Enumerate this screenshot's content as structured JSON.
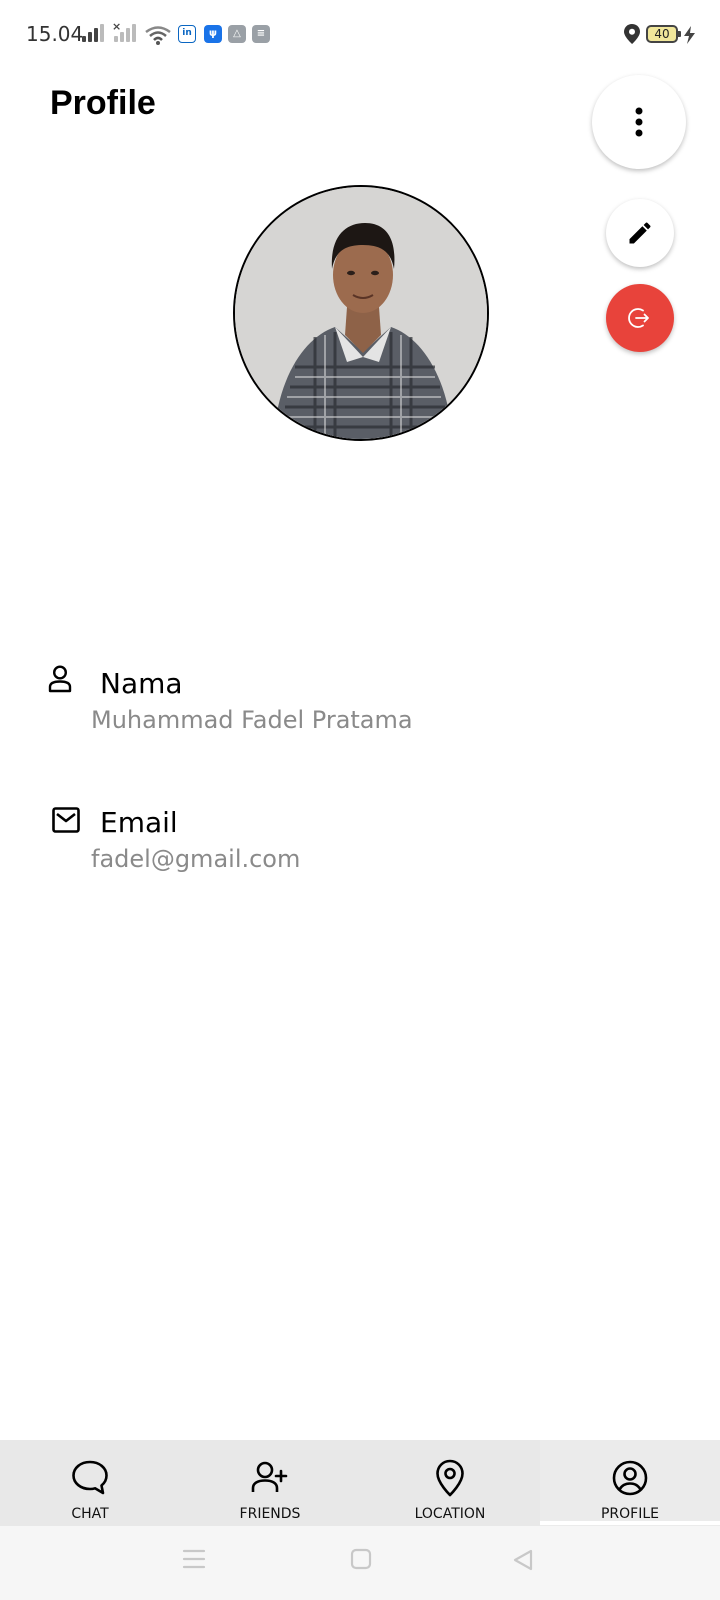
{
  "status_bar": {
    "time": "15.04",
    "battery_level": "40"
  },
  "header": {
    "title": "Profile"
  },
  "profile": {
    "name_label": "Nama",
    "name_value": "Muhammad Fadel Pratama",
    "email_label": "Email",
    "email_value": "fadel@gmail.com"
  },
  "bottom_nav": {
    "items": [
      {
        "label": "CHAT",
        "icon": "chat-bubble-icon"
      },
      {
        "label": "FRIENDS",
        "icon": "add-person-icon"
      },
      {
        "label": "LOCATION",
        "icon": "location-pin-icon"
      },
      {
        "label": "PROFILE",
        "icon": "account-circle-icon"
      }
    ],
    "active_index": 3
  },
  "colors": {
    "logout_fab": "#e8433b",
    "nav_background": "#e8e8e8",
    "value_text": "#8a8a8a"
  }
}
